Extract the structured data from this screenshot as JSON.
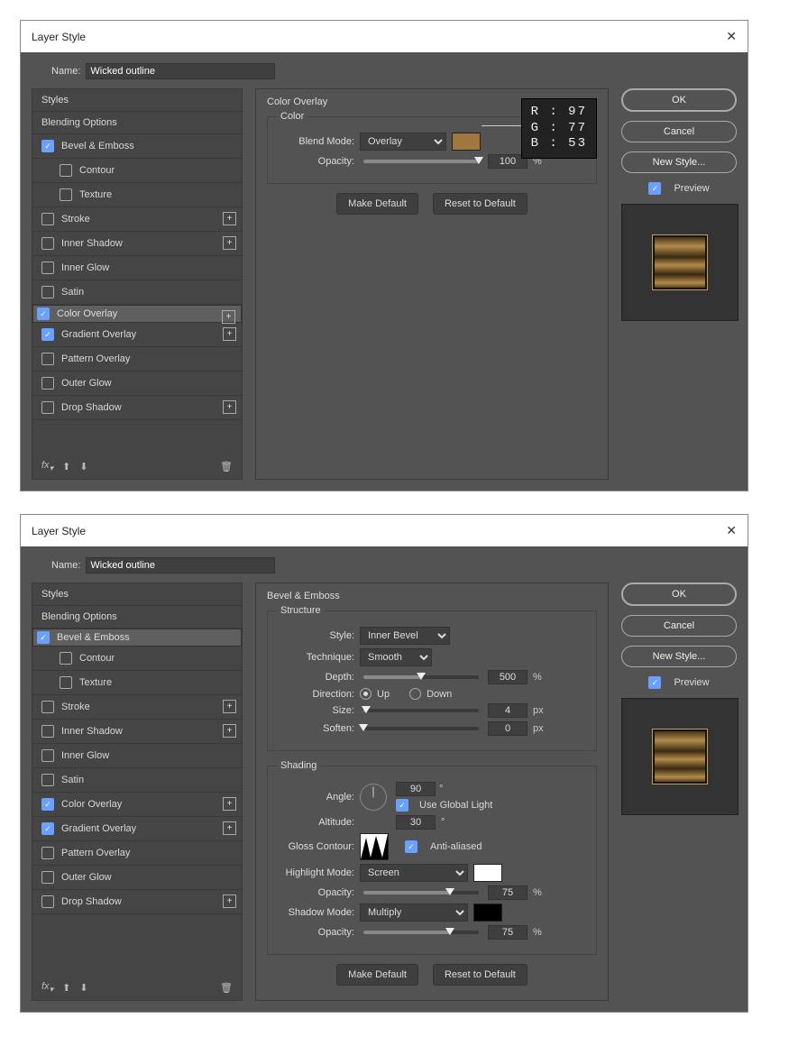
{
  "dialogs": [
    {
      "title": "Layer Style",
      "name_label": "Name:",
      "name_value": "Wicked outline",
      "styles_header": "Styles",
      "style_items": [
        {
          "label": "Blending Options",
          "has_cb": false
        },
        {
          "label": "Bevel & Emboss",
          "has_cb": true,
          "checked": true
        },
        {
          "label": "Contour",
          "has_cb": true,
          "checked": false,
          "sub": true
        },
        {
          "label": "Texture",
          "has_cb": true,
          "checked": false,
          "sub": true
        },
        {
          "label": "Stroke",
          "has_cb": true,
          "checked": false,
          "plus": true
        },
        {
          "label": "Inner Shadow",
          "has_cb": true,
          "checked": false,
          "plus": true
        },
        {
          "label": "Inner Glow",
          "has_cb": true,
          "checked": false
        },
        {
          "label": "Satin",
          "has_cb": true,
          "checked": false
        },
        {
          "label": "Color Overlay",
          "has_cb": true,
          "checked": true,
          "plus": true,
          "selected": true
        },
        {
          "label": "Gradient Overlay",
          "has_cb": true,
          "checked": true,
          "plus": true
        },
        {
          "label": "Pattern Overlay",
          "has_cb": true,
          "checked": false
        },
        {
          "label": "Outer Glow",
          "has_cb": true,
          "checked": false
        },
        {
          "label": "Drop Shadow",
          "has_cb": true,
          "checked": false,
          "plus": true
        }
      ],
      "center": {
        "panel_title": "Color Overlay",
        "group_title": "Color",
        "blend_mode_label": "Blend Mode:",
        "blend_mode_value": "Overlay",
        "swatch_hex": "#a0783f",
        "opacity_label": "Opacity:",
        "opacity_value": "100",
        "opacity_unit": "%",
        "make_default": "Make Default",
        "reset_default": "Reset to Default",
        "rgb": {
          "r": "R : 97",
          "g": "G : 77",
          "b": "B : 53"
        }
      },
      "right": {
        "ok": "OK",
        "cancel": "Cancel",
        "new_style": "New Style...",
        "preview_label": "Preview",
        "preview_checked": true
      }
    },
    {
      "title": "Layer Style",
      "name_label": "Name:",
      "name_value": "Wicked outline",
      "styles_header": "Styles",
      "style_items": [
        {
          "label": "Blending Options",
          "has_cb": false
        },
        {
          "label": "Bevel & Emboss",
          "has_cb": true,
          "checked": true,
          "selected": true
        },
        {
          "label": "Contour",
          "has_cb": true,
          "checked": false,
          "sub": true
        },
        {
          "label": "Texture",
          "has_cb": true,
          "checked": false,
          "sub": true
        },
        {
          "label": "Stroke",
          "has_cb": true,
          "checked": false,
          "plus": true
        },
        {
          "label": "Inner Shadow",
          "has_cb": true,
          "checked": false,
          "plus": true
        },
        {
          "label": "Inner Glow",
          "has_cb": true,
          "checked": false
        },
        {
          "label": "Satin",
          "has_cb": true,
          "checked": false
        },
        {
          "label": "Color Overlay",
          "has_cb": true,
          "checked": true,
          "plus": true
        },
        {
          "label": "Gradient Overlay",
          "has_cb": true,
          "checked": true,
          "plus": true
        },
        {
          "label": "Pattern Overlay",
          "has_cb": true,
          "checked": false
        },
        {
          "label": "Outer Glow",
          "has_cb": true,
          "checked": false
        },
        {
          "label": "Drop Shadow",
          "has_cb": true,
          "checked": false,
          "plus": true
        }
      ],
      "center": {
        "panel_title": "Bevel & Emboss",
        "structure_title": "Structure",
        "style_label": "Style:",
        "style_value": "Inner Bevel",
        "technique_label": "Technique:",
        "technique_value": "Smooth",
        "depth_label": "Depth:",
        "depth_value": "500",
        "depth_unit": "%",
        "direction_label": "Direction:",
        "direction_up": "Up",
        "direction_down": "Down",
        "direction_sel": "up",
        "size_label": "Size:",
        "size_value": "4",
        "size_unit": "px",
        "soften_label": "Soften:",
        "soften_value": "0",
        "soften_unit": "px",
        "shading_title": "Shading",
        "angle_label": "Angle:",
        "angle_value": "90",
        "angle_unit": "°",
        "use_global_label": "Use Global Light",
        "use_global_checked": true,
        "altitude_label": "Altitude:",
        "altitude_value": "30",
        "altitude_unit": "°",
        "gloss_label": "Gloss Contour:",
        "antialias_label": "Anti-aliased",
        "antialias_checked": true,
        "hmode_label": "Highlight Mode:",
        "hmode_value": "Screen",
        "hmode_swatch": "#ffffff",
        "hmode_op_label": "Opacity:",
        "hmode_op_value": "75",
        "hmode_op_unit": "%",
        "smode_label": "Shadow Mode:",
        "smode_value": "Multiply",
        "smode_swatch": "#000000",
        "smode_op_label": "Opacity:",
        "smode_op_value": "75",
        "smode_op_unit": "%",
        "make_default": "Make Default",
        "reset_default": "Reset to Default"
      },
      "right": {
        "ok": "OK",
        "cancel": "Cancel",
        "new_style": "New Style...",
        "preview_label": "Preview",
        "preview_checked": true
      }
    }
  ]
}
